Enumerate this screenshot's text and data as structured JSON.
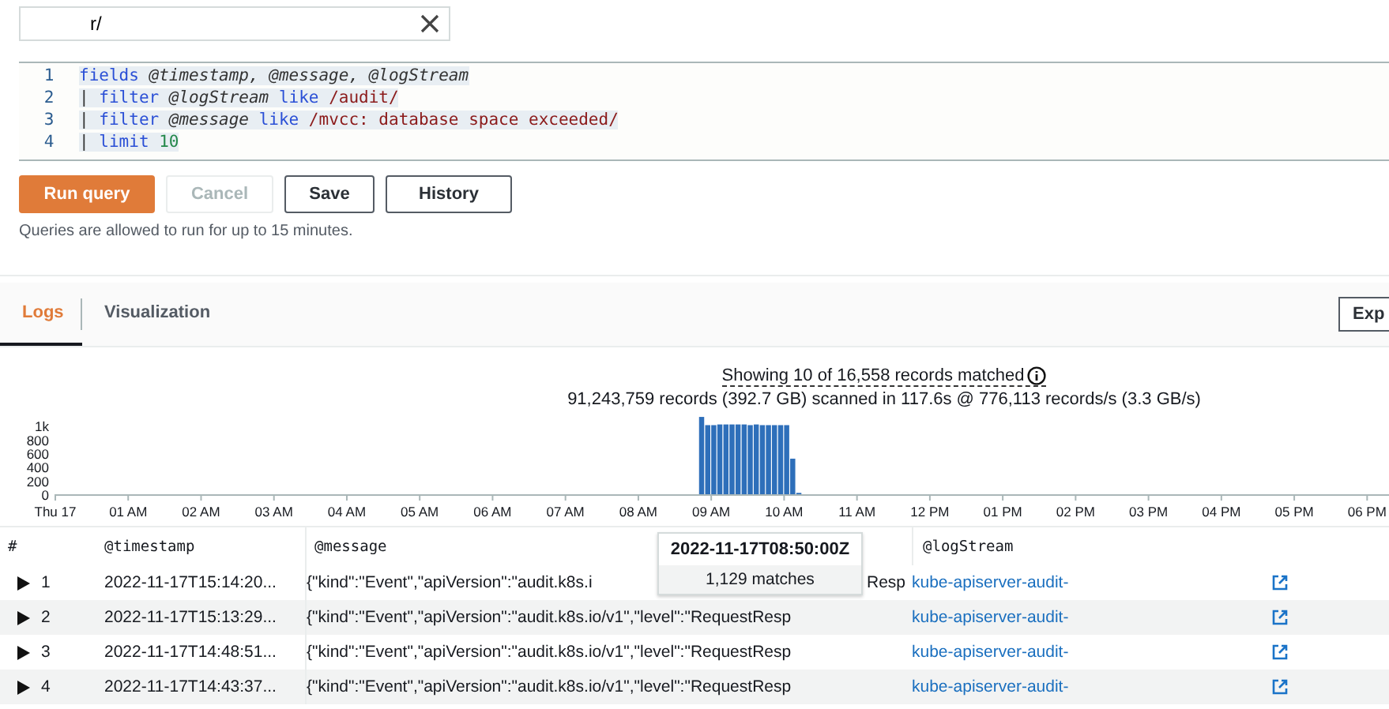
{
  "search": {
    "value": "r/"
  },
  "editor": {
    "lines": [
      {
        "number": "1",
        "tokens": [
          {
            "kind": "keyword",
            "text": "fields"
          },
          {
            "kind": "field",
            "text": " @timestamp, @message, @logStream"
          }
        ]
      },
      {
        "number": "2",
        "tokens": [
          {
            "kind": "plain",
            "text": "| "
          },
          {
            "kind": "keyword",
            "text": "filter"
          },
          {
            "kind": "field",
            "text": " @logStream"
          },
          {
            "kind": "keyword",
            "text": " like"
          },
          {
            "kind": "regex",
            "text": " /audit/"
          }
        ]
      },
      {
        "number": "3",
        "tokens": [
          {
            "kind": "plain",
            "text": "| "
          },
          {
            "kind": "keyword",
            "text": "filter"
          },
          {
            "kind": "field",
            "text": " @message"
          },
          {
            "kind": "keyword",
            "text": " like"
          },
          {
            "kind": "regex",
            "text": " /mvcc: database space exceeded/"
          }
        ]
      },
      {
        "number": "4",
        "tokens": [
          {
            "kind": "plain",
            "text": "| "
          },
          {
            "kind": "keyword",
            "text": "limit"
          },
          {
            "kind": "number",
            "text": " 10"
          }
        ]
      }
    ]
  },
  "buttons": [
    {
      "label": "Run query",
      "kind": "primary",
      "disabled": false
    },
    {
      "label": "Cancel",
      "kind": "normal",
      "disabled": true
    },
    {
      "label": "Save",
      "kind": "normal",
      "disabled": false
    },
    {
      "label": "History",
      "kind": "normal",
      "disabled": false
    }
  ],
  "note": "Queries are allowed to run for up to 15 minutes.",
  "tabs": [
    {
      "label": "Logs",
      "selected": true
    },
    {
      "label": "Visualization",
      "selected": false
    }
  ],
  "export_button": "Exp",
  "summary": {
    "matched": "Showing 10 of 16,558 records matched",
    "scanned": "91,243,759 records (392.7 GB) scanned in 117.6s @ 776,113 records/s (3.3 GB/s)"
  },
  "histogram": {
    "chart_data": {
      "type": "bar",
      "color": "#2e6fba",
      "x": [
        8.833,
        8.917,
        9.0,
        9.083,
        9.167,
        9.25,
        9.333,
        9.417,
        9.5,
        9.583,
        9.667,
        9.75,
        9.833,
        9.917,
        10.0,
        10.083,
        10.167
      ],
      "values": [
        1130,
        1010,
        1010,
        1020,
        1020,
        1020,
        1020,
        1020,
        1010,
        1020,
        1010,
        1010,
        1010,
        1010,
        1010,
        520,
        20
      ],
      "xlim": [
        0,
        18.3
      ],
      "ylim": [
        0,
        1200
      ],
      "yticks": [
        0,
        200,
        400,
        600,
        800,
        {
          "value": 1000,
          "label": "1k"
        }
      ],
      "xticks": [
        {
          "value": 0,
          "label": "Thu 17"
        },
        {
          "value": 1,
          "label": "01 AM"
        },
        {
          "value": 2,
          "label": "02 AM"
        },
        {
          "value": 3,
          "label": "03 AM"
        },
        {
          "value": 4,
          "label": "04 AM"
        },
        {
          "value": 5,
          "label": "05 AM"
        },
        {
          "value": 6,
          "label": "06 AM"
        },
        {
          "value": 7,
          "label": "07 AM"
        },
        {
          "value": 8,
          "label": "08 AM"
        },
        {
          "value": 9,
          "label": "09 AM"
        },
        {
          "value": 10,
          "label": "10 AM"
        },
        {
          "value": 11,
          "label": "11 AM"
        },
        {
          "value": 12,
          "label": "12 PM"
        }
      ]
    },
    "afternoon_labels": [
      "01 PM",
      "02 PM",
      "03 PM",
      "04 PM",
      "05 PM",
      "06 PM"
    ],
    "tooltip": {
      "title": "2022-11-17T08:50:00Z",
      "text": "1,129 matches"
    }
  },
  "table": {
    "columns": [
      "#",
      "@timestamp",
      "@message",
      "@logStream"
    ],
    "rows": [
      {
        "number": "1",
        "timestamp": "2022-11-17T15:14:20...",
        "message": "{\"kind\":\"Event\",\"apiVersion\":\"audit.k8s.i",
        "message_tail": "Resp",
        "log_stream": "kube-apiserver-audit-"
      },
      {
        "number": "2",
        "timestamp": "2022-11-17T15:13:29...",
        "message": "{\"kind\":\"Event\",\"apiVersion\":\"audit.k8s.io/v1\",\"level\":\"RequestResp",
        "log_stream": "kube-apiserver-audit-"
      },
      {
        "number": "3",
        "timestamp": "2022-11-17T14:48:51...",
        "message": "{\"kind\":\"Event\",\"apiVersion\":\"audit.k8s.io/v1\",\"level\":\"RequestResp",
        "log_stream": "kube-apiserver-audit-"
      },
      {
        "number": "4",
        "timestamp": "2022-11-17T14:43:37...",
        "message": "{\"kind\":\"Event\",\"apiVersion\":\"audit.k8s.io/v1\",\"level\":\"RequestResp",
        "log_stream": "kube-apiserver-audit-"
      }
    ]
  }
}
